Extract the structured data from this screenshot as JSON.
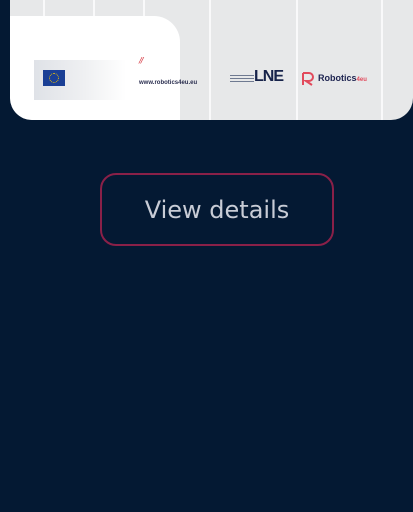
{
  "card": {
    "image": {
      "url_text": "www.robotics4eu.eu",
      "slash_mark": "//",
      "partner_logo_text": "LNE",
      "brand_name": "Robotics",
      "brand_suffix": "4eu",
      "icons": [
        "eu-flag-icon",
        "robotics-r-icon"
      ]
    }
  },
  "actions": {
    "view_details_label": "View details"
  },
  "colors": {
    "background": "#041933",
    "button_border": "#8a2048",
    "button_text": "#c8ccd6",
    "brand_accent": "#e24a5c"
  }
}
